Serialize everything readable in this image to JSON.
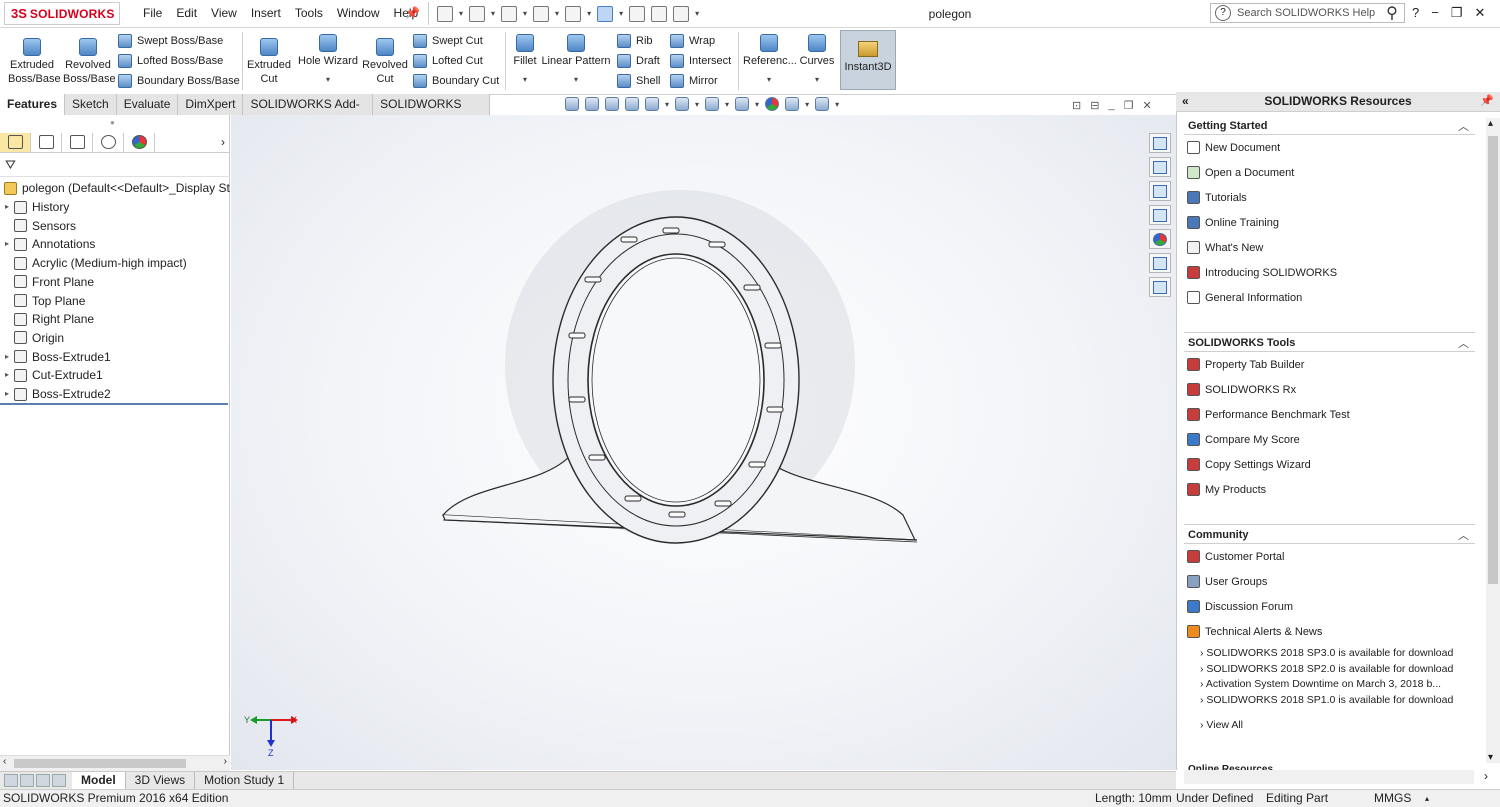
{
  "app": {
    "brand_prefix": "3S",
    "brand": "SOLIDWORKS",
    "doc_title": "polegon"
  },
  "menu": [
    "File",
    "Edit",
    "View",
    "Insert",
    "Tools",
    "Window",
    "Help"
  ],
  "search": {
    "placeholder": "Search SOLIDWORKS Help"
  },
  "window_controls": {
    "help": "?",
    "minimize": "−",
    "restore": "❐",
    "close": "✕"
  },
  "commands": {
    "extruded_boss": [
      "Extruded",
      "Boss/Base"
    ],
    "revolved_boss": [
      "Revolved",
      "Boss/Base"
    ],
    "swept_boss": "Swept Boss/Base",
    "lofted_boss": "Lofted Boss/Base",
    "boundary_boss": "Boundary Boss/Base",
    "extruded_cut": [
      "Extruded",
      "Cut"
    ],
    "hole_wizard": "Hole Wizard",
    "revolved_cut": [
      "Revolved",
      "Cut"
    ],
    "swept_cut": "Swept Cut",
    "lofted_cut": "Lofted Cut",
    "boundary_cut": "Boundary Cut",
    "fillet": "Fillet",
    "linear_pattern": "Linear Pattern",
    "rib": "Rib",
    "draft": "Draft",
    "shell": "Shell",
    "wrap": "Wrap",
    "intersect": "Intersect",
    "mirror": "Mirror",
    "reference": "Referenc...",
    "curves": "Curves",
    "instant3d": "Instant3D"
  },
  "tabs": [
    "Features",
    "Sketch",
    "Evaluate",
    "DimXpert",
    "SOLIDWORKS Add-Ins",
    "SOLIDWORKS MBD"
  ],
  "tree": {
    "root": "polegon  (Default<<Default>_Display St",
    "items": [
      {
        "label": "History",
        "expandable": true
      },
      {
        "label": "Sensors",
        "expandable": false
      },
      {
        "label": "Annotations",
        "expandable": true
      },
      {
        "label": "Acrylic (Medium-high impact)",
        "expandable": false
      },
      {
        "label": "Front Plane",
        "expandable": false
      },
      {
        "label": "Top Plane",
        "expandable": false
      },
      {
        "label": "Right Plane",
        "expandable": false
      },
      {
        "label": "Origin",
        "expandable": false
      },
      {
        "label": "Boss-Extrude1",
        "expandable": true
      },
      {
        "label": "Cut-Extrude1",
        "expandable": true
      },
      {
        "label": "Boss-Extrude2",
        "expandable": true
      }
    ]
  },
  "triad": {
    "x": "X",
    "y": "Y",
    "z": "Z"
  },
  "resources": {
    "title": "SOLIDWORKS Resources",
    "getting_started": {
      "title": "Getting Started",
      "items": [
        "New Document",
        "Open a Document",
        "Tutorials",
        "Online Training",
        "What's New",
        "Introducing SOLIDWORKS",
        "General Information"
      ]
    },
    "tools": {
      "title": "SOLIDWORKS Tools",
      "items": [
        "Property Tab Builder",
        "SOLIDWORKS Rx",
        "Performance Benchmark Test",
        "Compare My Score",
        "Copy Settings Wizard",
        "My Products"
      ]
    },
    "community": {
      "title": "Community",
      "items": [
        "Customer Portal",
        "User Groups",
        "Discussion Forum",
        "Technical Alerts & News"
      ],
      "alerts": [
        "SOLIDWORKS 2018 SP3.0 is available for download",
        "SOLIDWORKS 2018 SP2.0 is available for download",
        "Activation System Downtime on March 3, 2018 b...",
        "SOLIDWORKS 2018 SP1.0 is available for download"
      ],
      "view_all": "View All"
    },
    "online_resources": "Online Resources"
  },
  "bottom_tabs": [
    "Model",
    "3D Views",
    "Motion Study 1"
  ],
  "status": {
    "edition": "SOLIDWORKS Premium 2016 x64 Edition",
    "length": "Length: 10mm",
    "state": "Under Defined",
    "mode": "Editing Part",
    "units": "MMGS"
  },
  "colors": {
    "accent": "#d6001c",
    "link_blue": "#3a6fc8",
    "instant3d_bg": "#c9d3de"
  }
}
